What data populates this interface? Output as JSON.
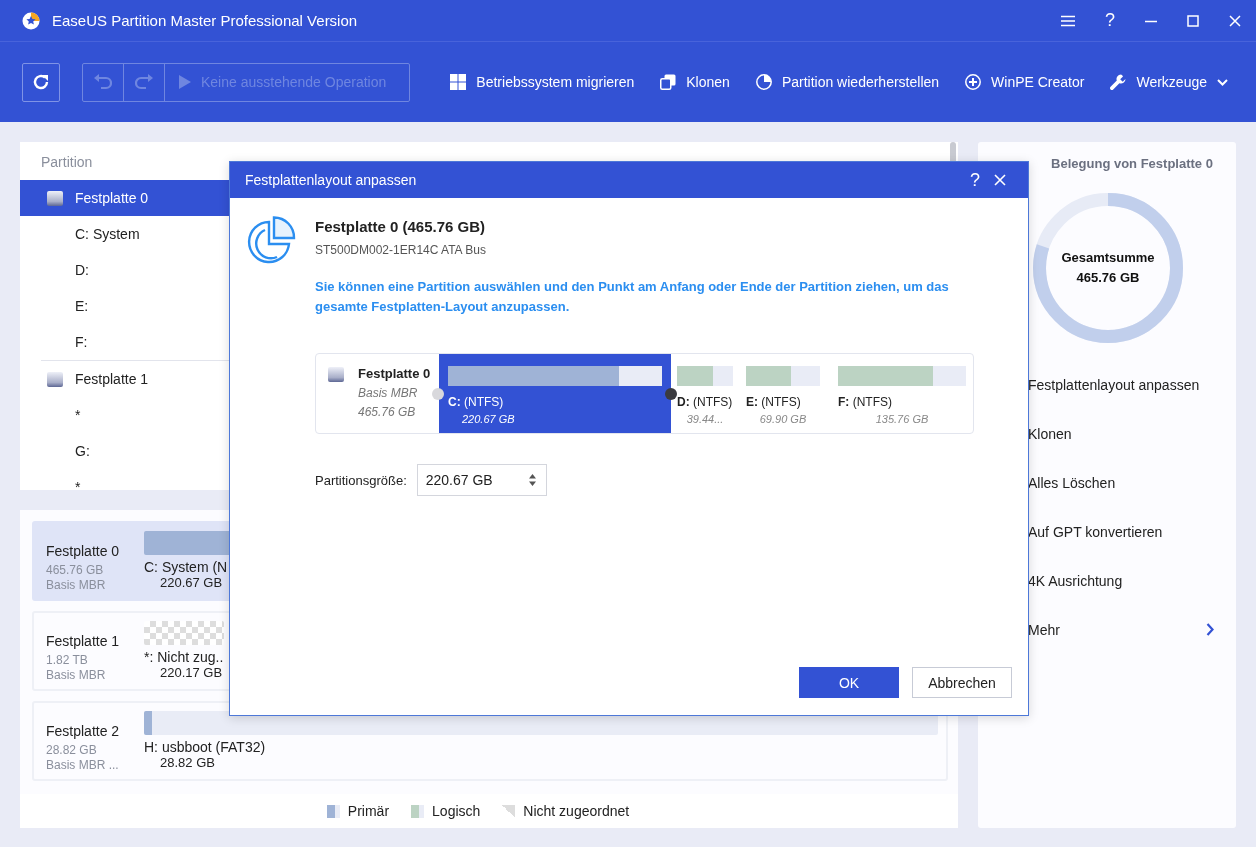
{
  "window": {
    "title": "EaseUS Partition Master Professional Version",
    "help": "?"
  },
  "toolbar": {
    "pending": {
      "label": "Keine ausstehende Operation",
      "disabled": true
    },
    "actions": [
      {
        "label": "Betriebssystem migrieren",
        "kind": "windows"
      },
      {
        "label": "Klonen",
        "kind": "clone"
      },
      {
        "label": "Partition wiederherstellen",
        "kind": "pie"
      },
      {
        "label": "WinPE Creator",
        "kind": "plus"
      },
      {
        "label": "Werkzeuge",
        "kind": "wrench",
        "dropdown": true
      }
    ]
  },
  "partition_tree": {
    "column": "Partition",
    "disks": [
      {
        "label": "Festplatte 0",
        "selected": true,
        "children": [
          {
            "label": "C: System",
            "selected": false
          },
          {
            "label": "D:",
            "selected": false
          },
          {
            "label": "E:",
            "selected": false
          },
          {
            "label": "F:",
            "selected": false
          }
        ]
      },
      {
        "label": "Festplatte 1",
        "selected": false,
        "children": [
          {
            "label": "*",
            "selected": false
          },
          {
            "label": "G:",
            "selected": false
          },
          {
            "label": "*",
            "selected": false
          }
        ]
      }
    ]
  },
  "disk_map": {
    "disks": [
      {
        "name": "Festplatte 0",
        "size": "465.76 GB",
        "type": "Basis MBR",
        "selected": true,
        "partition": {
          "label": "C: System (N",
          "size": "220.67 GB",
          "kind": "primary",
          "level": 1
        }
      },
      {
        "name": "Festplatte 1",
        "size": "1.82 TB",
        "type": "Basis MBR",
        "selected": false,
        "partition": {
          "label": "*: Nicht zug..",
          "size": "220.17 GB",
          "kind": "unallocated"
        }
      },
      {
        "name": "Festplatte 2",
        "size": "28.82 GB",
        "type": "Basis MBR ...",
        "selected": false,
        "partition": {
          "label": "H: usbboot (FAT32)",
          "size": "28.82 GB",
          "kind": "primary",
          "level": 0.01
        }
      }
    ],
    "legend": [
      {
        "label": "Primär",
        "kind": "primary"
      },
      {
        "label": "Logisch",
        "kind": "logical"
      },
      {
        "label": "Nicht zugeordnet",
        "kind": "unallocated"
      }
    ]
  },
  "side_panel": {
    "title": "Belegung von Festplatte 0",
    "usage": {
      "label": "Gesamtsumme",
      "total": "465.76 GB",
      "level": 0.8
    },
    "actions": [
      {
        "label": "Festplattenlayout anpassen"
      },
      {
        "label": "Klonen"
      },
      {
        "label": "Alles Löschen"
      },
      {
        "label": "Auf GPT konvertieren"
      },
      {
        "label": "4K Ausrichtung"
      },
      {
        "label": "Mehr",
        "submenu": true
      }
    ]
  },
  "dialog": {
    "title": "Festplattenlayout anpassen",
    "help": "?",
    "disk_title": "Festplatte 0 (465.76 GB)",
    "disk_model": "ST500DM002-1ER14C ATA Bus",
    "instruction": "Sie können eine Partition auswählen und den Punkt am Anfang oder Ende der Partition ziehen, um das gesamte Festplatten-Layout anzupassen.",
    "layout": {
      "disk": {
        "name": "Festplatte 0",
        "type": "Basis MBR",
        "size": "465.76 GB"
      },
      "partitions": [
        {
          "label": "**C:** (NTFS)",
          "size": "220.67 GB",
          "kind": "primary",
          "level": 0.8,
          "selected": true
        },
        {
          "label": "**D:** (NTFS)",
          "size": "39.44...",
          "kind": "logical",
          "level": 0.65,
          "selected": false
        },
        {
          "label": "**E:** (NTFS)",
          "size": "69.90 GB",
          "kind": "logical",
          "level": 0.61,
          "selected": false
        },
        {
          "label": "**F:** (NTFS)",
          "size": "135.76 GB",
          "kind": "logical",
          "level": 0.74,
          "selected": false
        }
      ]
    },
    "size_field": {
      "label": "Partitionsgröße:",
      "value": "220.67 GB"
    },
    "buttons": [
      {
        "label": "OK",
        "primary": true
      },
      {
        "label": "Abbrechen",
        "primary": false
      }
    ]
  }
}
